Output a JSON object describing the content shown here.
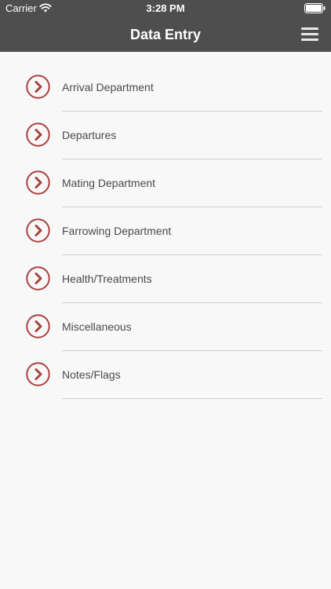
{
  "status_bar": {
    "carrier": "Carrier",
    "time": "3:28 PM"
  },
  "nav": {
    "title": "Data Entry",
    "menu_icon": "hamburger-menu-icon"
  },
  "colors": {
    "header_bg": "#4e4e4e",
    "accent": "#a8423d",
    "page_bg": "#f8f8f8"
  },
  "items": [
    {
      "label": "Arrival Department"
    },
    {
      "label": "Departures"
    },
    {
      "label": "Mating Department"
    },
    {
      "label": "Farrowing Department"
    },
    {
      "label": "Health/Treatments"
    },
    {
      "label": "Miscellaneous"
    },
    {
      "label": "Notes/Flags"
    }
  ]
}
